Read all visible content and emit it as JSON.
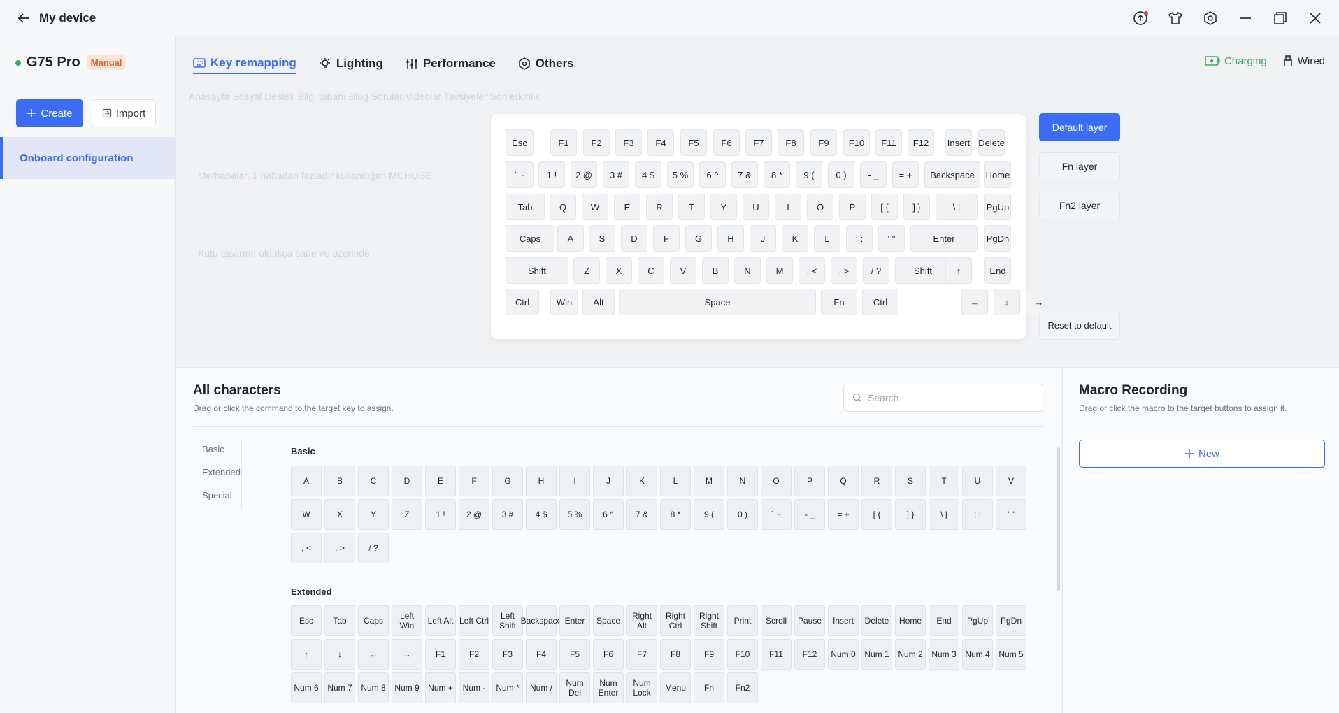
{
  "app": {
    "title": "My device"
  },
  "device": {
    "name": "G75 Pro",
    "mode": "Manual"
  },
  "sidebar": {
    "create_label": "Create",
    "import_label": "Import",
    "config_item": "Onboard configuration"
  },
  "tabs": [
    {
      "label": "Key remapping",
      "icon": "keyboard-icon",
      "active": true
    },
    {
      "label": "Lighting",
      "icon": "lightbulb-icon",
      "active": false
    },
    {
      "label": "Performance",
      "icon": "sliders-icon",
      "active": false
    },
    {
      "label": "Others",
      "icon": "hexagon-icon",
      "active": false
    }
  ],
  "status": {
    "charging": "Charging",
    "connection": "Wired"
  },
  "keyboard_rows": [
    [
      "Esc",
      "F1",
      "F2",
      "F3",
      "F4",
      "F5",
      "F6",
      "F7",
      "F8",
      "F9",
      "F10",
      "F11",
      "F12",
      "Insert",
      "Delete"
    ],
    [
      "` ~",
      "1 !",
      "2 @",
      "3 #",
      "4 $",
      "5 %",
      "6 ^",
      "7 &",
      "8 *",
      "9 (",
      "0 )",
      "- _",
      "= +",
      "Backspace",
      "Home"
    ],
    [
      "Tab",
      "Q",
      "W",
      "E",
      "R",
      "T",
      "Y",
      "U",
      "I",
      "O",
      "P",
      "[ {",
      "] }",
      "\\ |",
      "PgUp"
    ],
    [
      "Caps",
      "A",
      "S",
      "D",
      "F",
      "G",
      "H",
      "J",
      "K",
      "L",
      "; :",
      "' \"",
      "Enter",
      "PgDn"
    ],
    [
      "Shift",
      "Z",
      "X",
      "C",
      "V",
      "B",
      "N",
      "M",
      ", <",
      ". >",
      "/ ?",
      "Shift",
      "↑",
      "End"
    ],
    [
      "Ctrl",
      "Win",
      "Alt",
      "Space",
      "Fn",
      "Ctrl",
      "←",
      "↓",
      "→"
    ]
  ],
  "layers": [
    "Default layer",
    "Fn layer",
    "Fn2 layer"
  ],
  "reset_label": "Reset to default",
  "chars": {
    "title": "All characters",
    "subtitle": "Drag or click the command to the target key to assign.",
    "search_placeholder": "Search",
    "categories": [
      "Basic",
      "Extended",
      "Special"
    ],
    "basic_label": "Basic",
    "basic_keys": [
      "A",
      "B",
      "C",
      "D",
      "E",
      "F",
      "G",
      "H",
      "I",
      "J",
      "K",
      "L",
      "M",
      "N",
      "O",
      "P",
      "Q",
      "R",
      "S",
      "T",
      "U",
      "V",
      "W",
      "X",
      "Y",
      "Z",
      "1 !",
      "2 @",
      "3 #",
      "4 $",
      "5 %",
      "6 ^",
      "7 &",
      "8 *",
      "9 (",
      "0 )",
      "` ~",
      "- _",
      "= +",
      "[ {",
      "] }",
      "\\ |",
      "; :",
      "' \"",
      ", <",
      ". >",
      "/ ?"
    ],
    "extended_label": "Extended",
    "extended_keys": [
      "Esc",
      "Tab",
      "Caps",
      "Left Win",
      "Left Alt",
      "Left Ctrl",
      "Left Shift",
      "Backspace",
      "Enter",
      "Space",
      "Right Alt",
      "Right Ctrl",
      "Right Shift",
      "Print",
      "Scroll",
      "Pause",
      "Insert",
      "Delete",
      "Home",
      "End",
      "PgUp",
      "PgDn",
      "↑",
      "↓",
      "←",
      "→",
      "F1",
      "F2",
      "F3",
      "F4",
      "F5",
      "F6",
      "F7",
      "F8",
      "F9",
      "F10",
      "F11",
      "F12",
      "Num 0",
      "Num 1",
      "Num 2",
      "Num 3",
      "Num 4",
      "Num 5",
      "Num 6",
      "Num 7",
      "Num 8",
      "Num 9",
      "Num +",
      "Num -",
      "Num *",
      "Num /",
      "Num Del",
      "Num Enter",
      "Num Lock",
      "Menu",
      "Fn",
      "Fn2"
    ]
  },
  "macro": {
    "title": "Macro Recording",
    "subtitle": "Drag or click the macro to the target buttons to assign it.",
    "new_label": "New"
  },
  "colors": {
    "accent": "#3a6cf4",
    "charging": "#3aa55c",
    "badge": "#e2632a",
    "online": "#2fb36a"
  }
}
